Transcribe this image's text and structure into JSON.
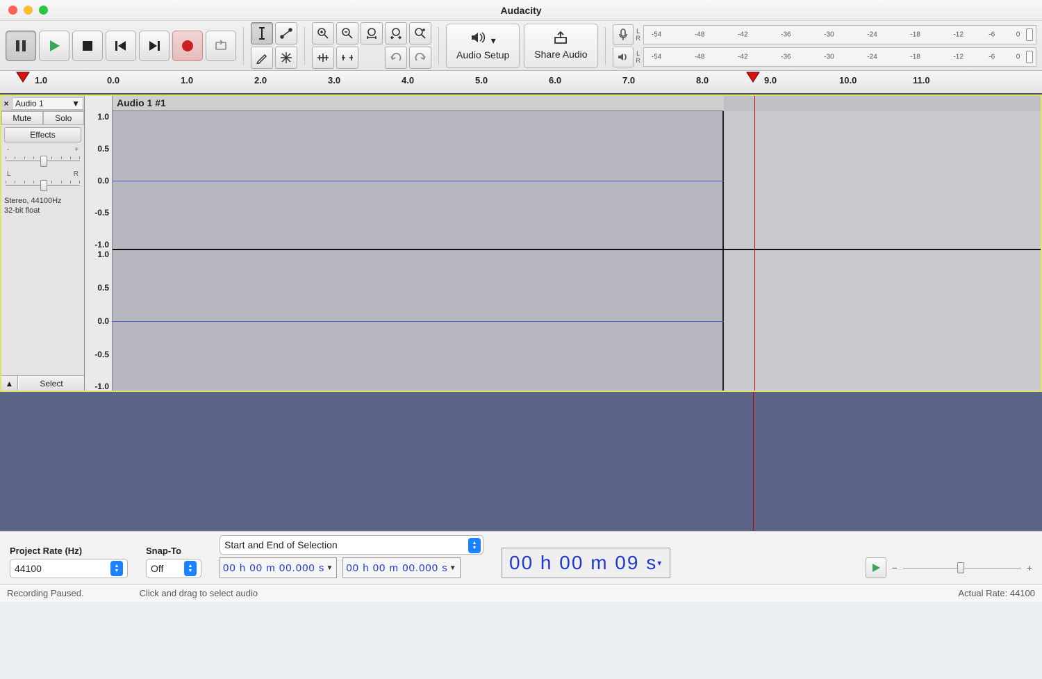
{
  "app": {
    "title": "Audacity"
  },
  "toolbar": {
    "audio_setup": "Audio Setup",
    "share_audio": "Share Audio"
  },
  "meter": {
    "L": "L",
    "R": "R",
    "db_labels": [
      "-54",
      "-48",
      "-42",
      "-36",
      "-30",
      "-24",
      "-18",
      "-12",
      "-6",
      "0"
    ]
  },
  "timeline": {
    "labels": [
      "1.0",
      "0.0",
      "1.0",
      "2.0",
      "3.0",
      "4.0",
      "5.0",
      "6.0",
      "7.0",
      "8.0",
      "9.0",
      "10.0",
      "11.0"
    ],
    "play_position": 9.0,
    "clip_start": 0.0,
    "clip_end": 8.3
  },
  "track": {
    "name": "Audio 1",
    "clip_title": "Audio 1 #1",
    "mute": "Mute",
    "solo": "Solo",
    "effects": "Effects",
    "gain_left": "-",
    "gain_right": "+",
    "pan_left": "L",
    "pan_right": "R",
    "info_line1": "Stereo, 44100Hz",
    "info_line2": "32-bit float",
    "select": "Select",
    "amp_labels": [
      "1.0",
      "0.5",
      "0.0",
      "-0.5",
      "-1.0"
    ]
  },
  "bottom": {
    "project_rate_label": "Project Rate (Hz)",
    "project_rate_value": "44100",
    "snapto_label": "Snap-To",
    "snapto_value": "Off",
    "selection_mode": "Start and End of Selection",
    "sel_start": "00 h 00 m 00.000 s",
    "sel_end": "00 h 00 m 00.000 s",
    "big_time": "00 h 00 m 09 s",
    "pb_minus": "−",
    "pb_plus": "+"
  },
  "status": {
    "left": "Recording Paused.",
    "center": "Click and drag to select audio",
    "right": "Actual Rate: 44100"
  }
}
